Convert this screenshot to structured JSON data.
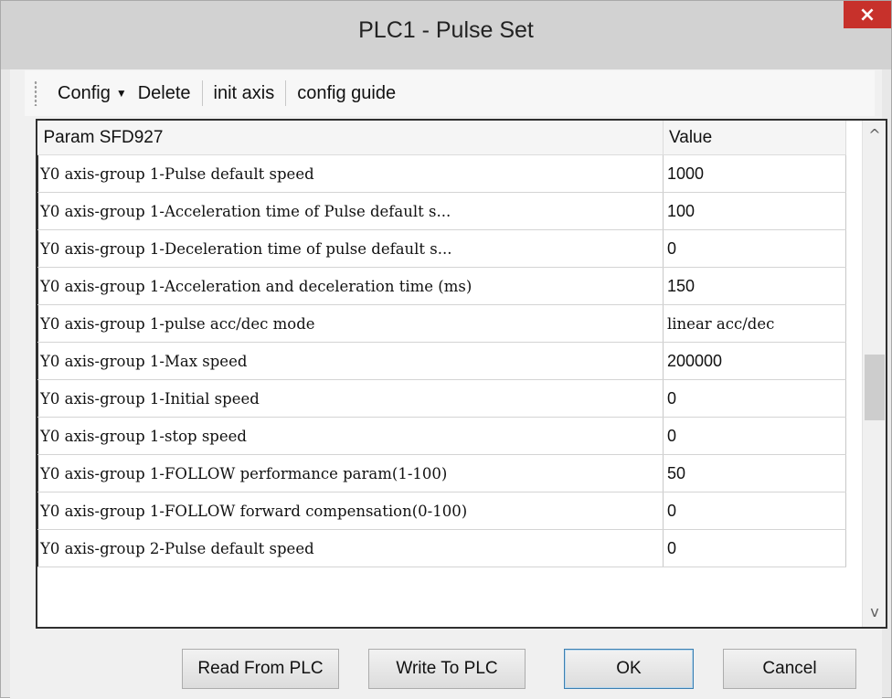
{
  "window": {
    "title": "PLC1 - Pulse  Set",
    "close_glyph": "×",
    "close_color": "#c7312b"
  },
  "toolbar": {
    "config_label": "Config",
    "delete_label": "Delete",
    "init_axis_label": "init axis",
    "config_guide_label": "config guide"
  },
  "table": {
    "headers": [
      "Param SFD927",
      "Value"
    ],
    "rows": [
      {
        "param": "Y0 axis-group 1-Pulse default speed",
        "value": "1000"
      },
      {
        "param": "Y0 axis-group 1-Acceleration time of Pulse default s...",
        "value": "100"
      },
      {
        "param": "Y0 axis-group 1-Deceleration time of pulse default s...",
        "value": "0"
      },
      {
        "param": "Y0 axis-group 1-Acceleration and deceleration time (ms)",
        "value": "150"
      },
      {
        "param": "Y0 axis-group 1-pulse acc/dec mode",
        "value": "linear acc/dec"
      },
      {
        "param": "Y0 axis-group 1-Max speed",
        "value": "200000"
      },
      {
        "param": "Y0 axis-group 1-Initial speed",
        "value": "0"
      },
      {
        "param": "Y0 axis-group 1-stop speed",
        "value": "0"
      },
      {
        "param": "Y0 axis-group 1-FOLLOW performance param(1-100)",
        "value": "50"
      },
      {
        "param": "Y0 axis-group 1-FOLLOW forward compensation(0-100)",
        "value": "0"
      },
      {
        "param": "Y0 axis-group 2-Pulse default speed",
        "value": "0"
      }
    ]
  },
  "buttons": {
    "read": "Read From PLC",
    "write": "Write To PLC",
    "ok": "OK",
    "cancel": "Cancel"
  },
  "scrollbar": {
    "up_glyph": "^",
    "down_glyph": "v",
    "position_fraction": 0.5
  }
}
